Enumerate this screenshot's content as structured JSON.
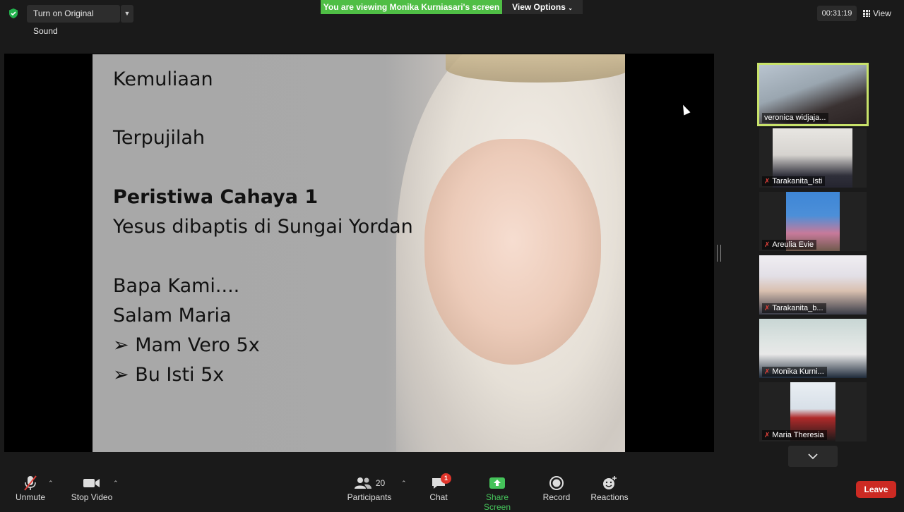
{
  "top_bar": {
    "sound_button": "Turn on Original Sound",
    "viewing_banner": "You are viewing Monika Kurniasari's screen",
    "view_options": "View Options",
    "timer": "00:31:19",
    "view_button": "View"
  },
  "slide": {
    "line1": "Kemuliaan",
    "line2": "Terpujilah",
    "line3": "Peristiwa Cahaya 1",
    "line4": "Yesus dibaptis di Sungai Yordan",
    "line5": "Bapa Kami....",
    "line6": "Salam Maria",
    "line7": "➢ Mam Vero 5x",
    "line8": "➢ Bu Isti 5x"
  },
  "participants": [
    {
      "name": "veronica widjaja...",
      "muted": false,
      "active": true
    },
    {
      "name": "Tarakanita_Isti",
      "muted": true
    },
    {
      "name": "Areulia Evie",
      "muted": true
    },
    {
      "name": "Tarakanita_b...",
      "muted": true
    },
    {
      "name": "Monika Kurni...",
      "muted": true
    },
    {
      "name": "Maria Theresia",
      "muted": true
    }
  ],
  "toolbar": {
    "unmute": "Unmute",
    "stop_video": "Stop Video",
    "participants": "Participants",
    "participants_count": "20",
    "chat": "Chat",
    "chat_badge": "1",
    "share_screen": "Share Screen",
    "record": "Record",
    "reactions": "Reactions",
    "leave": "Leave"
  },
  "colors": {
    "banner_green": "#4fbe45",
    "active_speaker": "#c8e26a",
    "leave_red": "#cc2a23",
    "share_green": "#45c35a"
  }
}
